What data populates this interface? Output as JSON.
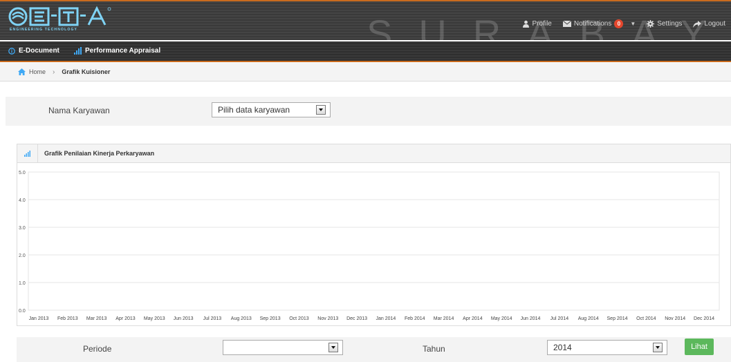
{
  "brand": {
    "logo_text": "E-T-A",
    "tagline": "ENGINEERING TECHNOLOGY",
    "watermark": "SURABAYA"
  },
  "topnav": {
    "profile": "Profile",
    "notifications": "Notifications",
    "notification_count": "0",
    "settings": "Settings",
    "logout": "Logout"
  },
  "modules": {
    "edocument": "E-Document",
    "performance": "Performance Appraisal"
  },
  "breadcrumb": {
    "home": "Home",
    "current": "Grafik Kuisioner"
  },
  "filter": {
    "label": "Nama Karyawan",
    "select_value": "Pilih data karyawan"
  },
  "chart_panel": {
    "title": "Grafik Penilaian Kinerja Perkaryawan"
  },
  "chart_data": {
    "type": "line",
    "title": "Grafik Penilaian Kinerja Perkaryawan",
    "xlabel": "",
    "ylabel": "",
    "ylim": [
      0,
      5
    ],
    "y_ticks": [
      "5.0",
      "4.0",
      "3.0",
      "2.0",
      "1.0",
      "0.0"
    ],
    "categories": [
      "Jan 2013",
      "Feb 2013",
      "Mar 2013",
      "Apr 2013",
      "May 2013",
      "Jun 2013",
      "Jul 2013",
      "Aug 2013",
      "Sep 2013",
      "Oct 2013",
      "Nov 2013",
      "Dec 2013",
      "Jan 2014",
      "Feb 2014",
      "Mar 2014",
      "Apr 2014",
      "May 2014",
      "Jun 2014",
      "Jul 2014",
      "Aug 2014",
      "Sep 2014",
      "Oct 2014",
      "Nov 2014",
      "Dec 2014"
    ],
    "series": [],
    "grid": true,
    "gridline_color": "#e6e6e6"
  },
  "bottom": {
    "periode_label": "Periode",
    "periode_value": "",
    "tahun_label": "Tahun",
    "tahun_value": "2014",
    "submit": "Lihat"
  },
  "colors": {
    "accent_orange": "#c96b1e",
    "button_green": "#5cb85c",
    "badge_red": "#e4472d",
    "icon_blue": "#3fa9f5"
  }
}
